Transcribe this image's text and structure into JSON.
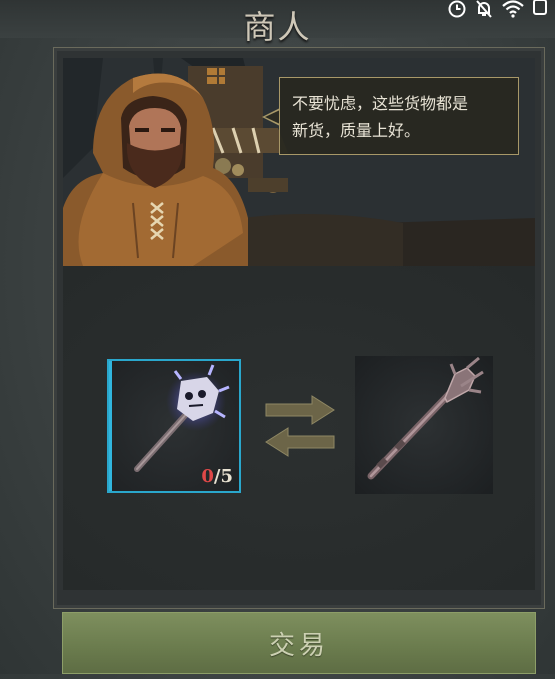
{
  "header": {
    "title": "商人"
  },
  "status_bar": {
    "icons": [
      "clock-icon",
      "mute-bell-icon",
      "wifi-icon",
      "battery-icon"
    ]
  },
  "merchant": {
    "dialogue_line1": "不要忧虑，这些货物都是",
    "dialogue_line2": "新货，质量上好。"
  },
  "trade": {
    "give_item": {
      "icon": "skull-mace-icon",
      "count_have": "0",
      "count_need": "5"
    },
    "receive_item": {
      "icon": "spiked-mace-icon"
    },
    "exchange_icon": "exchange-arrows-icon"
  },
  "actions": {
    "trade_label": "交易"
  },
  "colors": {
    "accent_blue": "#2aa7cc",
    "button_green": "#6f8050",
    "count_red": "#e04848",
    "bubble_border": "#a89868"
  }
}
